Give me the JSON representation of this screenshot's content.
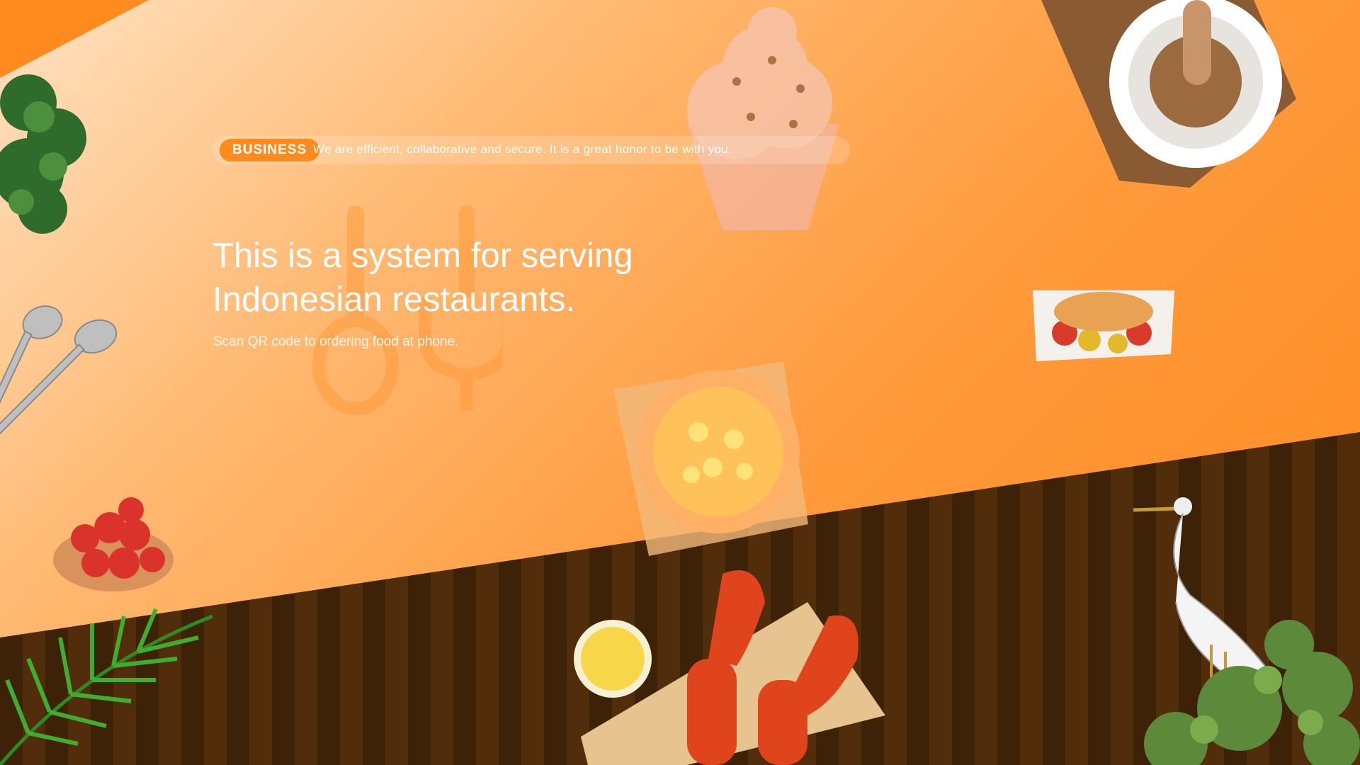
{
  "badge": {
    "label": "BUSINESS",
    "tagline": "We are efficient, collaborative and secure. It is a great honor to be with you."
  },
  "hero": {
    "title_line1": "This is a system for serving",
    "title_line2": "Indonesian restaurants.",
    "subtitle": "Scan QR code to ordering food at phone."
  },
  "colors": {
    "accent": "#ff8a1e",
    "floor_dark": "#3e2208",
    "floor_stripe": "#512d0c",
    "text": "#ffffff"
  },
  "icons": [
    "spoon-fork-watermark",
    "cupcake",
    "mortar-and-pestle",
    "grilled-fish-plate",
    "pasta-plate",
    "lobster-board",
    "lemon-slice",
    "heron-bird",
    "strawberry-bowl",
    "palm-leaf",
    "spoons",
    "shrub",
    "green-bush"
  ]
}
